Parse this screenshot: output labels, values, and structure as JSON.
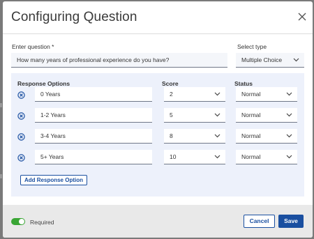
{
  "dialog": {
    "title": "Configuring Question",
    "close_icon": "close-icon"
  },
  "question": {
    "label": "Enter question *",
    "value": "How many years of professional experience do you have?"
  },
  "type": {
    "label": "Select type",
    "value": "Multiple Choice"
  },
  "options": {
    "headers": {
      "response": "Response Options",
      "score": "Score",
      "status": "Status"
    },
    "rows": [
      {
        "response": "0 Years",
        "score": "2",
        "status": "Normal"
      },
      {
        "response": "1-2 Years",
        "score": "5",
        "status": "Normal"
      },
      {
        "response": "3-4 Years",
        "score": "8",
        "status": "Normal"
      },
      {
        "response": "5+ Years",
        "score": "10",
        "status": "Normal"
      }
    ],
    "add_label": "Add Response Option"
  },
  "footer": {
    "required_label": "Required",
    "required_on": true,
    "cancel_label": "Cancel",
    "save_label": "Save"
  },
  "colors": {
    "accent": "#1a4fa0",
    "toggle_on": "#3aa635",
    "panel_bg": "#edf1fb"
  }
}
